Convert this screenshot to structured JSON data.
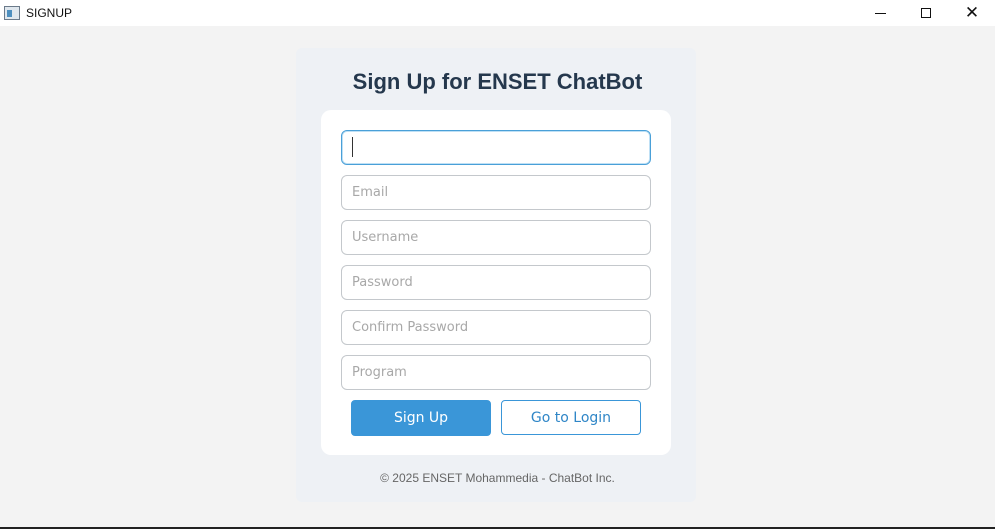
{
  "window": {
    "title": "SIGNUP",
    "controls": {
      "minimize": "minimize",
      "maximize": "maximize",
      "close": "close"
    }
  },
  "form": {
    "heading": "Sign Up for ENSET ChatBot",
    "fields": [
      {
        "name": "fullname",
        "placeholder": "",
        "value": ""
      },
      {
        "name": "email",
        "placeholder": "Email",
        "value": ""
      },
      {
        "name": "username",
        "placeholder": "Username",
        "value": ""
      },
      {
        "name": "password",
        "placeholder": "Password",
        "value": ""
      },
      {
        "name": "confirm_password",
        "placeholder": "Confirm Password",
        "value": ""
      },
      {
        "name": "program",
        "placeholder": "Program",
        "value": ""
      }
    ],
    "signup_label": "Sign Up",
    "login_label": "Go to Login"
  },
  "footer": {
    "text": "© 2025 ENSET Mohammedia - ChatBot Inc."
  },
  "colors": {
    "accent": "#3a96d8",
    "heading": "#25384d",
    "panel": "#eef1f5",
    "card": "#ffffff",
    "background": "#f3f3f3"
  },
  "icons": [
    "app-icon",
    "minimize-icon",
    "maximize-icon",
    "close-icon"
  ]
}
